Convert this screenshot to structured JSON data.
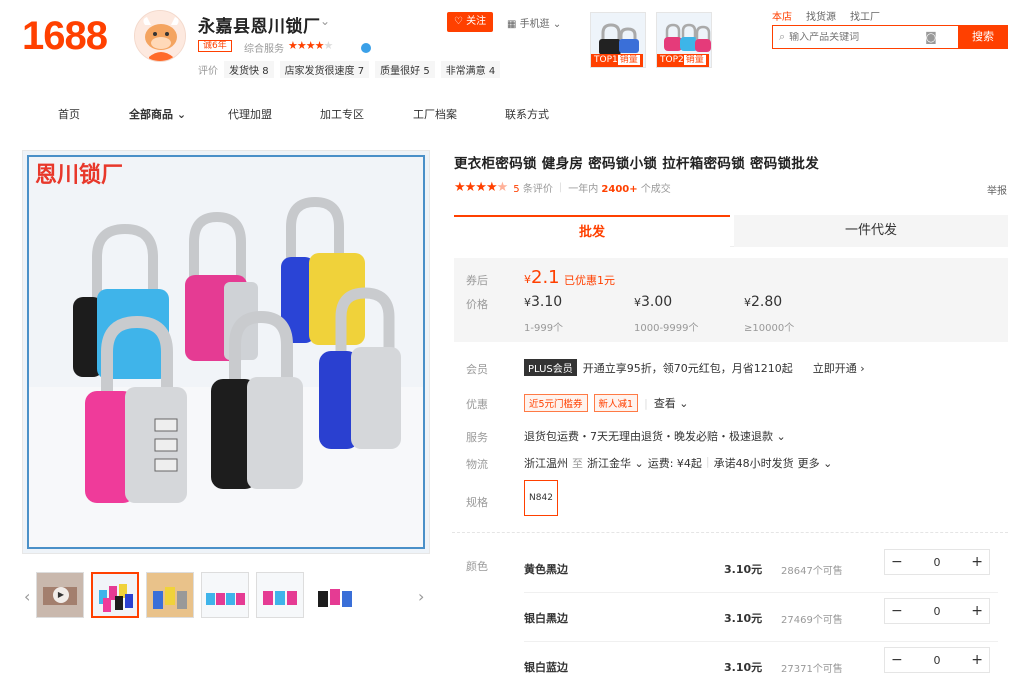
{
  "brand": {
    "logo": "1688",
    "color": "#ff4000"
  },
  "shop": {
    "name": "永嘉县恩川锁厂",
    "year_badge": "诚6年",
    "service_label": "综合服务",
    "rating_label": "评价",
    "ratings": [
      {
        "label": "发货快",
        "score": "8"
      },
      {
        "label": "店家发货很速度",
        "score": "7"
      },
      {
        "label": "质量很好",
        "score": "5"
      },
      {
        "label": "非常满意",
        "score": "4"
      }
    ],
    "follow": "关注",
    "mobile": "手机逛"
  },
  "top_items": [
    {
      "rank": "TOP1",
      "label": "销量"
    },
    {
      "rank": "TOP2",
      "label": "销量"
    }
  ],
  "search": {
    "tabs": [
      "本店",
      "找货源",
      "找工厂"
    ],
    "placeholder": "输入产品关键词",
    "button": "搜索"
  },
  "nav": [
    "首页",
    "全部商品",
    "代理加盟",
    "加工专区",
    "工厂档案",
    "联系方式"
  ],
  "gallery": {
    "watermark": "恩川锁厂"
  },
  "product": {
    "title": "更衣柜密码锁 健身房 密码锁小锁 拉杆箱密码锁 密码锁批发",
    "review_count": "5",
    "review_text": "条评价",
    "year_label": "一年内",
    "sold": "2400+",
    "sold_text": "个成交",
    "report": "举报"
  },
  "tabs": {
    "wholesale": "批发",
    "dropship": "一件代发"
  },
  "price": {
    "coupon_label": "券后",
    "coupon_price": "2.1",
    "coupon_note": "已优惠1元",
    "price_label": "价格",
    "tiers": [
      {
        "price": "3.10",
        "range": "1-999个"
      },
      {
        "price": "3.00",
        "range": "1000-9999个"
      },
      {
        "price": "2.80",
        "range": "≥10000个"
      }
    ],
    "currency": "¥"
  },
  "member": {
    "label": "会员",
    "badge": "PLUS会员",
    "text": "开通立享95折，领70元红包，月省1210起",
    "link": "立即开通"
  },
  "promo": {
    "label": "优惠",
    "chips": [
      "近5元门槛券",
      "新人减1"
    ],
    "view": "查看"
  },
  "service": {
    "label": "服务",
    "text": "退货包运费・7天无理由退货・晚发必赔・极速退款"
  },
  "logistics": {
    "label": "物流",
    "from": "浙江温州",
    "to_word": "至",
    "dest": "浙江金华",
    "fee": "运费: ¥4起",
    "promise": "承诺48小时发货",
    "more": "更多"
  },
  "spec": {
    "label": "规格",
    "value": "N842"
  },
  "colors": {
    "label": "颜色",
    "items": [
      {
        "name": "黄色黑边",
        "price": "3.10元",
        "stock": "28647",
        "stock_unit": "个可售",
        "qty": "0"
      },
      {
        "name": "银白黑边",
        "price": "3.10元",
        "stock": "27469",
        "stock_unit": "个可售",
        "qty": "0"
      },
      {
        "name": "银白蓝边",
        "price": "3.10元",
        "stock": "27371",
        "stock_unit": "个可售",
        "qty": "0"
      }
    ]
  }
}
